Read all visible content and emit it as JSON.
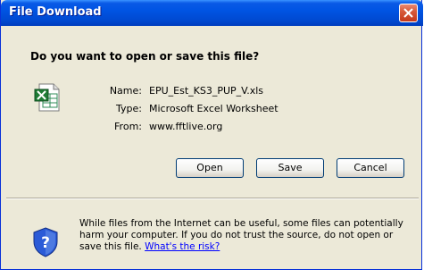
{
  "window": {
    "title": "File Download"
  },
  "dialog": {
    "question": "Do you want to open or save this file?",
    "file": {
      "name_label": "Name:",
      "name_value": "EPU_Est_KS3_PUP_V.xls",
      "type_label": "Type:",
      "type_value": "Microsoft Excel Worksheet",
      "from_label": "From:",
      "from_value": "www.fftlive.org"
    },
    "buttons": {
      "open": "Open",
      "save": "Save",
      "cancel": "Cancel"
    },
    "warning": {
      "text": "While files from the Internet can be useful, some files can potentially harm your computer. If you do not trust the source, do not open or save this file.",
      "link": "What's the risk?"
    }
  },
  "icons": {
    "title_close": "close-icon",
    "file": "excel-file-icon",
    "security": "security-shield-icon"
  },
  "colors": {
    "titlebar": "#0054e3",
    "dialog_bg": "#ece9d8",
    "close_button": "#d75a3a",
    "link": "#0000ff"
  }
}
